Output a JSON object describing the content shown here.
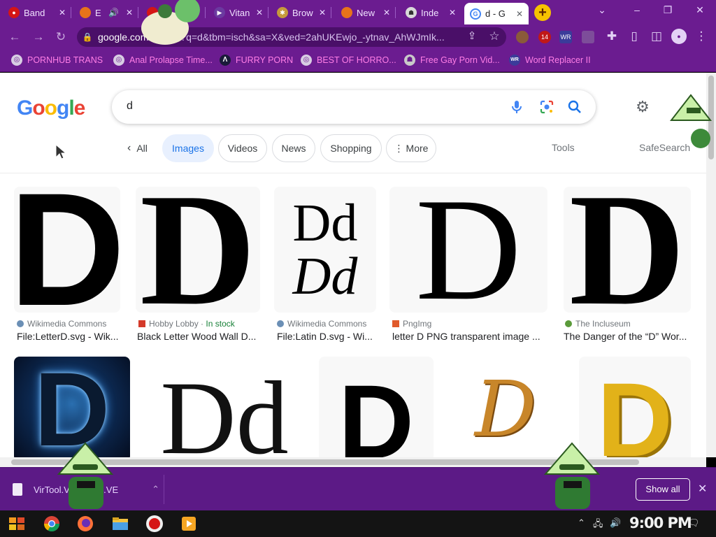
{
  "tabs": [
    {
      "title": "Band",
      "favicon_color": "#d51515"
    },
    {
      "title": "E",
      "favicon_color": "#e8731a"
    },
    {
      "title": "",
      "favicon_color": "#d51515"
    },
    {
      "title": "Vitan",
      "favicon_color": "#6b3aa0"
    },
    {
      "title": "Brow",
      "favicon_color": "#c69a3c"
    },
    {
      "title": "New",
      "favicon_color": "#e8731a"
    },
    {
      "title": "Inde",
      "favicon_color": "#d9d9d9"
    },
    {
      "title": "d - G",
      "favicon_color": "#4285f4",
      "active": true
    }
  ],
  "new_tab_label": "+",
  "window_controls": {
    "minimize": "–",
    "maximize": "❐",
    "close": "✕",
    "tabsearch": "⌄"
  },
  "address": {
    "host": "google.com",
    "path": "/search?q=d&tbm=isch&sa=X&ved=2ahUKEwjo_-ytnav_AhWJmIk..."
  },
  "extensions": {
    "badge_14": "14"
  },
  "bookmarks": [
    {
      "label": "PORNHUB TRANS",
      "icon": "globe-icon"
    },
    {
      "label": "Anal Prolapse Time...",
      "icon": "globe-icon"
    },
    {
      "label": "FURRY PORN",
      "icon": "a-logo-icon"
    },
    {
      "label": "BEST OF HORRO...",
      "icon": "globe-icon"
    },
    {
      "label": "Free Gay Porn Vid...",
      "icon": "site-icon"
    },
    {
      "label": "Word Replacer II",
      "icon": "wr-icon"
    }
  ],
  "search": {
    "query": "d"
  },
  "filters": [
    {
      "label": "All",
      "back": true
    },
    {
      "label": "Images",
      "selected": true
    },
    {
      "label": "Videos"
    },
    {
      "label": "News"
    },
    {
      "label": "Shopping"
    },
    {
      "label": "More",
      "kebab": true
    }
  ],
  "tools_label": "Tools",
  "safesearch_label": "SafeSearch",
  "results_row1": [
    {
      "source": "Wikimedia Commons",
      "title": "File:LetterD.svg - Wik...",
      "glyph": "D",
      "style": "sans",
      "fav": "#6b8fb5"
    },
    {
      "source": "Hobby Lobby",
      "stock": "In stock",
      "title": "Black Letter Wood Wall D...",
      "glyph": "D",
      "style": "serif-bold",
      "fav": "#d43a2a"
    },
    {
      "source": "Wikimedia Commons",
      "title": "File:Latin D.svg - Wi...",
      "glyph": "Dd",
      "glyph2": "Dd",
      "style": "latin",
      "fav": "#6b8fb5"
    },
    {
      "source": "PngImg",
      "title": "letter D PNG transparent image ...",
      "glyph": "D",
      "style": "serif",
      "fav": "#e05a2b"
    },
    {
      "source": "The Incluseum",
      "title": "The Danger of the “D” Wor...",
      "glyph": "D",
      "style": "serif-bold",
      "fav": "#5a9a3a"
    }
  ],
  "results_row2": [
    {
      "glyph": "D",
      "style": "electric"
    },
    {
      "glyph": "Dd",
      "style": "serif"
    },
    {
      "glyph": "D",
      "style": "sans"
    },
    {
      "glyph": "D",
      "style": "gold-script"
    },
    {
      "glyph": "D",
      "style": "gold-3d"
    }
  ],
  "download": {
    "filename": "VirTool.VBS!MTB.VE",
    "show_all": "Show all"
  },
  "taskbar": {
    "clock": "9:00 PM"
  },
  "colors": {
    "chrome_purple": "#6b1c90",
    "bookmark_pink": "#ff7ee6",
    "google_blue": "#1a73e8"
  }
}
